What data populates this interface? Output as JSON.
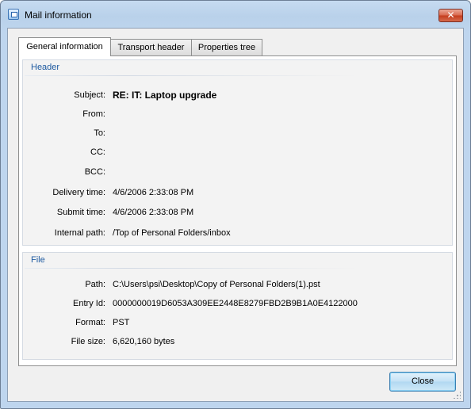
{
  "window": {
    "title": "Mail information",
    "close_glyph": "✕"
  },
  "tabs": [
    {
      "label": "General information",
      "active": true
    },
    {
      "label": "Transport header",
      "active": false
    },
    {
      "label": "Properties tree",
      "active": false
    }
  ],
  "header_group": {
    "title": "Header",
    "fields": [
      {
        "label": "Subject:",
        "value": "RE: IT: Laptop upgrade",
        "bold": true
      },
      {
        "label": "From:",
        "value": ""
      },
      {
        "label": "To:",
        "value": ""
      },
      {
        "label": "CC:",
        "value": ""
      },
      {
        "label": "BCC:",
        "value": ""
      },
      {
        "label": "Delivery time:",
        "value": "4/6/2006 2:33:08 PM"
      },
      {
        "label": "Submit time:",
        "value": "4/6/2006 2:33:08 PM"
      },
      {
        "label": "Internal path:",
        "value": "/Top of Personal Folders/inbox"
      }
    ]
  },
  "file_group": {
    "title": "File",
    "fields": [
      {
        "label": "Path:",
        "value": "C:\\Users\\psi\\Desktop\\Copy of Personal Folders(1).pst"
      },
      {
        "label": "Entry Id:",
        "value": "0000000019D6053A309EE2448E8279FBD2B9B1A0E4122000"
      },
      {
        "label": "Format:",
        "value": "PST"
      },
      {
        "label": "File size:",
        "value": "6,620,160 bytes"
      }
    ]
  },
  "buttons": {
    "close_label": "Close"
  },
  "icons": {
    "window_icon": "mail-info-icon",
    "close_icon": "close-icon"
  }
}
